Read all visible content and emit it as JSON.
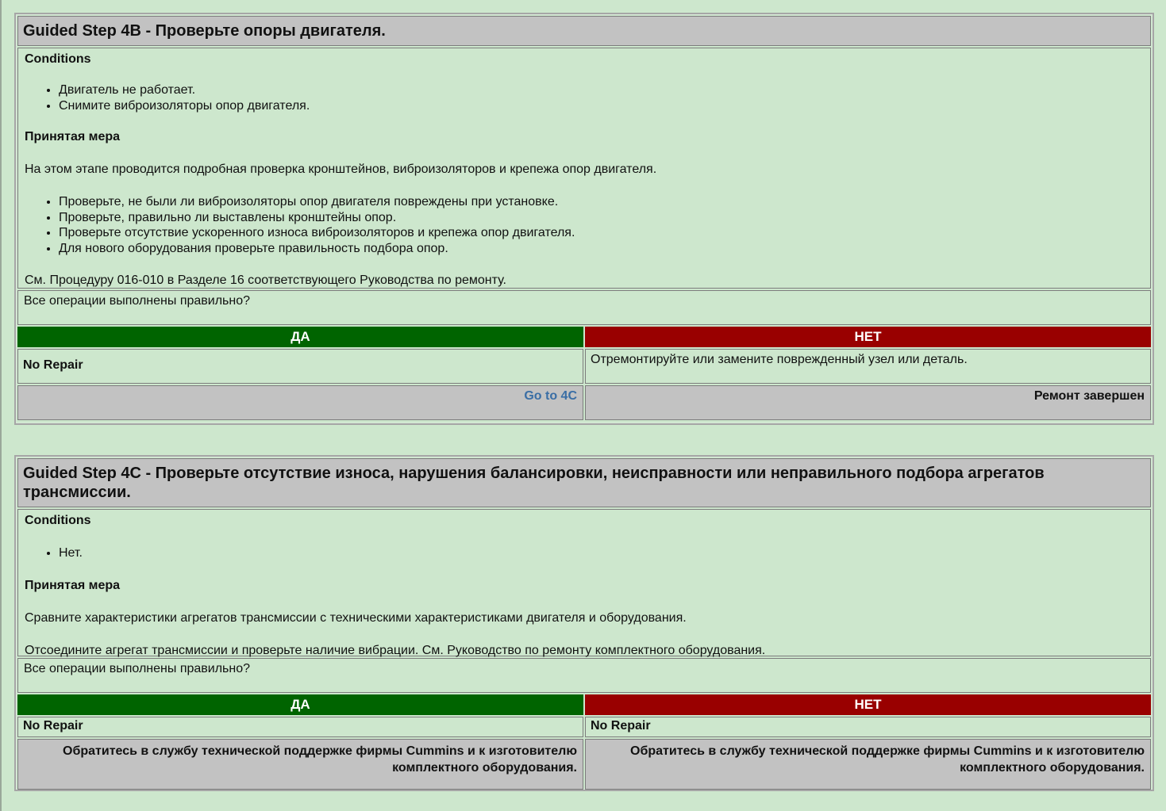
{
  "step4b": {
    "title": "Guided Step 4B - Проверьте опоры двигателя.",
    "conditions_label": "Conditions",
    "conditions": [
      "Двигатель не работает.",
      "Снимите виброизоляторы опор двигателя."
    ],
    "action_label": "Принятая мера",
    "intro": "На этом этапе проводится подробная проверка кронштейнов, виброизоляторов и крепежа опор двигателя.",
    "checks": [
      "Проверьте, не были ли виброизоляторы опор двигателя повреждены при установке.",
      "Проверьте, правильно ли выставлены кронштейны опор.",
      "Проверьте отсутствие ускоренного износа виброизоляторов и крепежа опор двигателя.",
      "Для нового оборудования проверьте правильность подбора опор."
    ],
    "reference": "См. Процедуру 016-010 в Разделе 16 соответствующего Руководства по ремонту.",
    "question": "Все операции выполнены правильно?",
    "yes_label": "ДА",
    "no_label": "НЕТ",
    "yes_result": "No Repair",
    "no_result": "Отремонтируйте или замените поврежденный узел или деталь.",
    "yes_action": "Go to 4C",
    "no_action": "Ремонт завершен"
  },
  "step4c": {
    "title": "Guided Step 4C - Проверьте отсутствие износа, нарушения балансировки, неисправности или неправильного подбора агрегатов трансмиссии.",
    "conditions_label": "Conditions",
    "conditions": [
      "Нет."
    ],
    "action_label": "Принятая мера",
    "para1": "Сравните характеристики агрегатов трансмиссии с техническими характеристиками двигателя и оборудования.",
    "para2": "Отсоедините агрегат трансмиссии и проверьте наличие вибрации. См. Руководство по ремонту комплектного оборудования.",
    "question": "Все операции выполнены правильно?",
    "yes_label": "ДА",
    "no_label": "НЕТ",
    "yes_result": "No Repair",
    "no_result": "No Repair",
    "yes_action": "Обратитесь в службу технической поддержке фирмы Cummins и к изготовителю комплектного оборудования.",
    "no_action": "Обратитесь в службу технической поддержке фирмы Cummins и к изготовителю комплектного оборудования."
  },
  "colors": {
    "background": "#cde7cd",
    "header_gray": "#c2c2c2",
    "yes_green": "#006400",
    "no_red": "#990000",
    "link_blue": "#3a6ea5"
  }
}
